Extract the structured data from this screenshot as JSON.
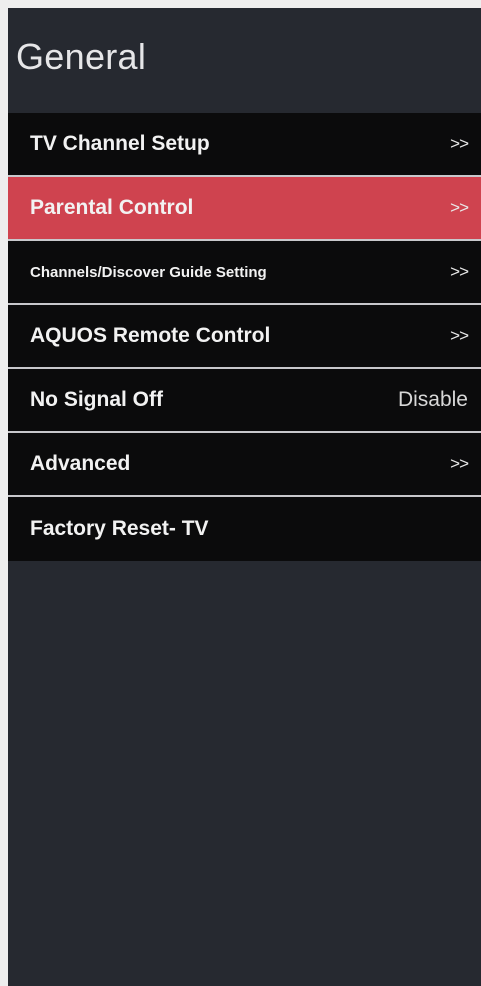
{
  "header": {
    "title": "General"
  },
  "colors": {
    "panel_bg": "#262930",
    "item_bg": "#0b0b0c",
    "selected_bg": "#cf434f"
  },
  "menu": {
    "items": [
      {
        "label": "TV Channel Setup",
        "trail": ">>"
      },
      {
        "label": "Parental Control",
        "trail": ">>",
        "selected": true
      },
      {
        "label": "Channels/Discover Guide Setting",
        "trail": ">>"
      },
      {
        "label": "AQUOS Remote Control",
        "trail": ">>"
      },
      {
        "label": "No Signal Off",
        "value": "Disable"
      },
      {
        "label": "Advanced",
        "trail": ">>"
      },
      {
        "label": "Factory Reset- TV"
      }
    ]
  }
}
